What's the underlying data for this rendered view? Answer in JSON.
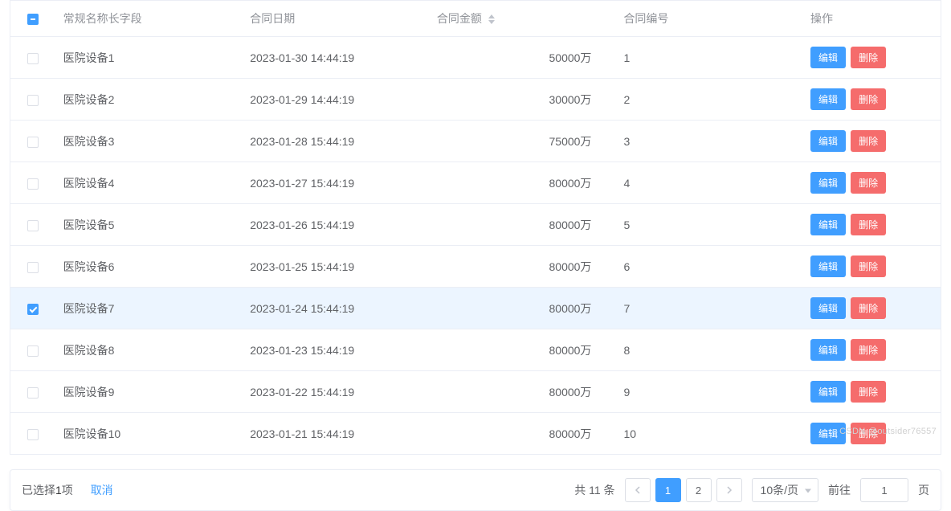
{
  "table": {
    "headers": {
      "name": "常规名称长字段",
      "date": "合同日期",
      "amount": "合同金额",
      "number": "合同编号",
      "actions": "操作"
    },
    "rows": [
      {
        "name": "医院设备1",
        "date": "2023-01-30 14:44:19",
        "amount": "50000万",
        "number": "1",
        "checked": false
      },
      {
        "name": "医院设备2",
        "date": "2023-01-29 14:44:19",
        "amount": "30000万",
        "number": "2",
        "checked": false
      },
      {
        "name": "医院设备3",
        "date": "2023-01-28 15:44:19",
        "amount": "75000万",
        "number": "3",
        "checked": false
      },
      {
        "name": "医院设备4",
        "date": "2023-01-27 15:44:19",
        "amount": "80000万",
        "number": "4",
        "checked": false
      },
      {
        "name": "医院设备5",
        "date": "2023-01-26 15:44:19",
        "amount": "80000万",
        "number": "5",
        "checked": false
      },
      {
        "name": "医院设备6",
        "date": "2023-01-25 15:44:19",
        "amount": "80000万",
        "number": "6",
        "checked": false
      },
      {
        "name": "医院设备7",
        "date": "2023-01-24 15:44:19",
        "amount": "80000万",
        "number": "7",
        "checked": true
      },
      {
        "name": "医院设备8",
        "date": "2023-01-23 15:44:19",
        "amount": "80000万",
        "number": "8",
        "checked": false
      },
      {
        "name": "医院设备9",
        "date": "2023-01-22 15:44:19",
        "amount": "80000万",
        "number": "9",
        "checked": false
      },
      {
        "name": "医院设备10",
        "date": "2023-01-21 15:44:19",
        "amount": "80000万",
        "number": "10",
        "checked": false
      }
    ],
    "action_labels": {
      "edit": "编辑",
      "delete": "删除"
    },
    "header_checkbox_state": "indeterminate"
  },
  "footer": {
    "selected_prefix": "已选择",
    "selected_count": "1",
    "selected_suffix": "项",
    "cancel": "取消",
    "total_text": "共 11 条",
    "pages": [
      "1",
      "2"
    ],
    "active_page": "1",
    "page_size_label": "10条/页",
    "jumper_prefix": "前往",
    "jumper_value": "1",
    "jumper_suffix": "页"
  },
  "watermark": "CSDN @outsider76557"
}
